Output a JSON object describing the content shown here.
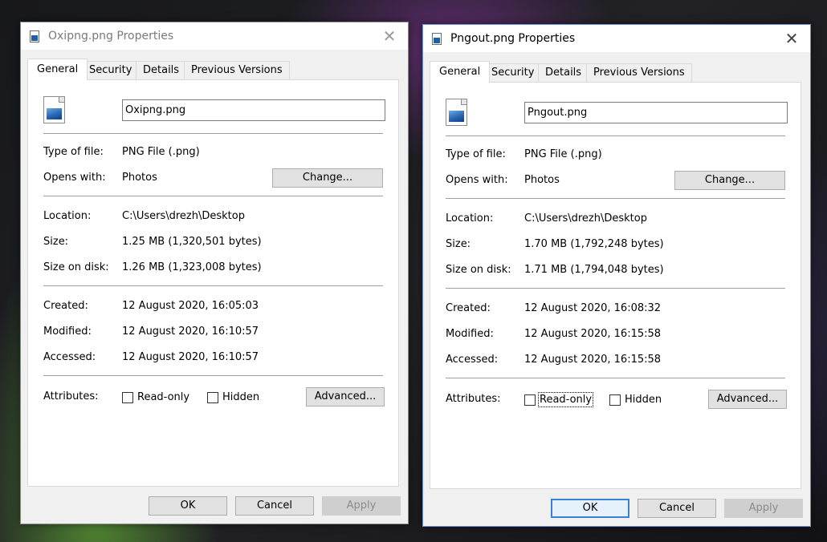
{
  "dialogs": [
    {
      "title": "Oxipng.png Properties",
      "close_glyph": "✕",
      "tabs": [
        "General",
        "Security",
        "Details",
        "Previous Versions"
      ],
      "filename": "Oxipng.png",
      "type_label": "Type of file:",
      "type_value": "PNG File (.png)",
      "opens_label": "Opens with:",
      "opens_value": "Photos",
      "change_button": "Change...",
      "location_label": "Location:",
      "location_value": "C:\\Users\\drezh\\Desktop",
      "size_label": "Size:",
      "size_value": "1.25 MB (1,320,501 bytes)",
      "disk_label": "Size on disk:",
      "disk_value": "1.26 MB (1,323,008 bytes)",
      "created_label": "Created:",
      "created_value": "12 August 2020, 16:05:03",
      "modified_label": "Modified:",
      "modified_value": "12 August 2020, 16:10:57",
      "accessed_label": "Accessed:",
      "accessed_value": "12 August 2020, 16:10:57",
      "attributes_label": "Attributes:",
      "readonly_label": "Read-only",
      "hidden_label": "Hidden",
      "readonly_checked": false,
      "hidden_checked": false,
      "advanced_button": "Advanced...",
      "ok_button": "OK",
      "cancel_button": "Cancel",
      "apply_button": "Apply",
      "active": false
    },
    {
      "title": "Pngout.png Properties",
      "close_glyph": "✕",
      "tabs": [
        "General",
        "Security",
        "Details",
        "Previous Versions"
      ],
      "filename": "Pngout.png",
      "type_label": "Type of file:",
      "type_value": "PNG File (.png)",
      "opens_label": "Opens with:",
      "opens_value": "Photos",
      "change_button": "Change...",
      "location_label": "Location:",
      "location_value": "C:\\Users\\drezh\\Desktop",
      "size_label": "Size:",
      "size_value": "1.70 MB (1,792,248 bytes)",
      "disk_label": "Size on disk:",
      "disk_value": "1.71 MB (1,794,048 bytes)",
      "created_label": "Created:",
      "created_value": "12 August 2020, 16:08:32",
      "modified_label": "Modified:",
      "modified_value": "12 August 2020, 16:15:58",
      "accessed_label": "Accessed:",
      "accessed_value": "12 August 2020, 16:15:58",
      "attributes_label": "Attributes:",
      "readonly_label": "Read-only",
      "hidden_label": "Hidden",
      "readonly_checked": false,
      "hidden_checked": false,
      "advanced_button": "Advanced...",
      "ok_button": "OK",
      "cancel_button": "Cancel",
      "apply_button": "Apply",
      "active": true
    }
  ],
  "colors": {
    "dialog_bg": "#f0f0f0",
    "panel_bg": "#ffffff",
    "focus_blue": "#3c80d8",
    "inactive_title_text": "#7a7a7a"
  }
}
